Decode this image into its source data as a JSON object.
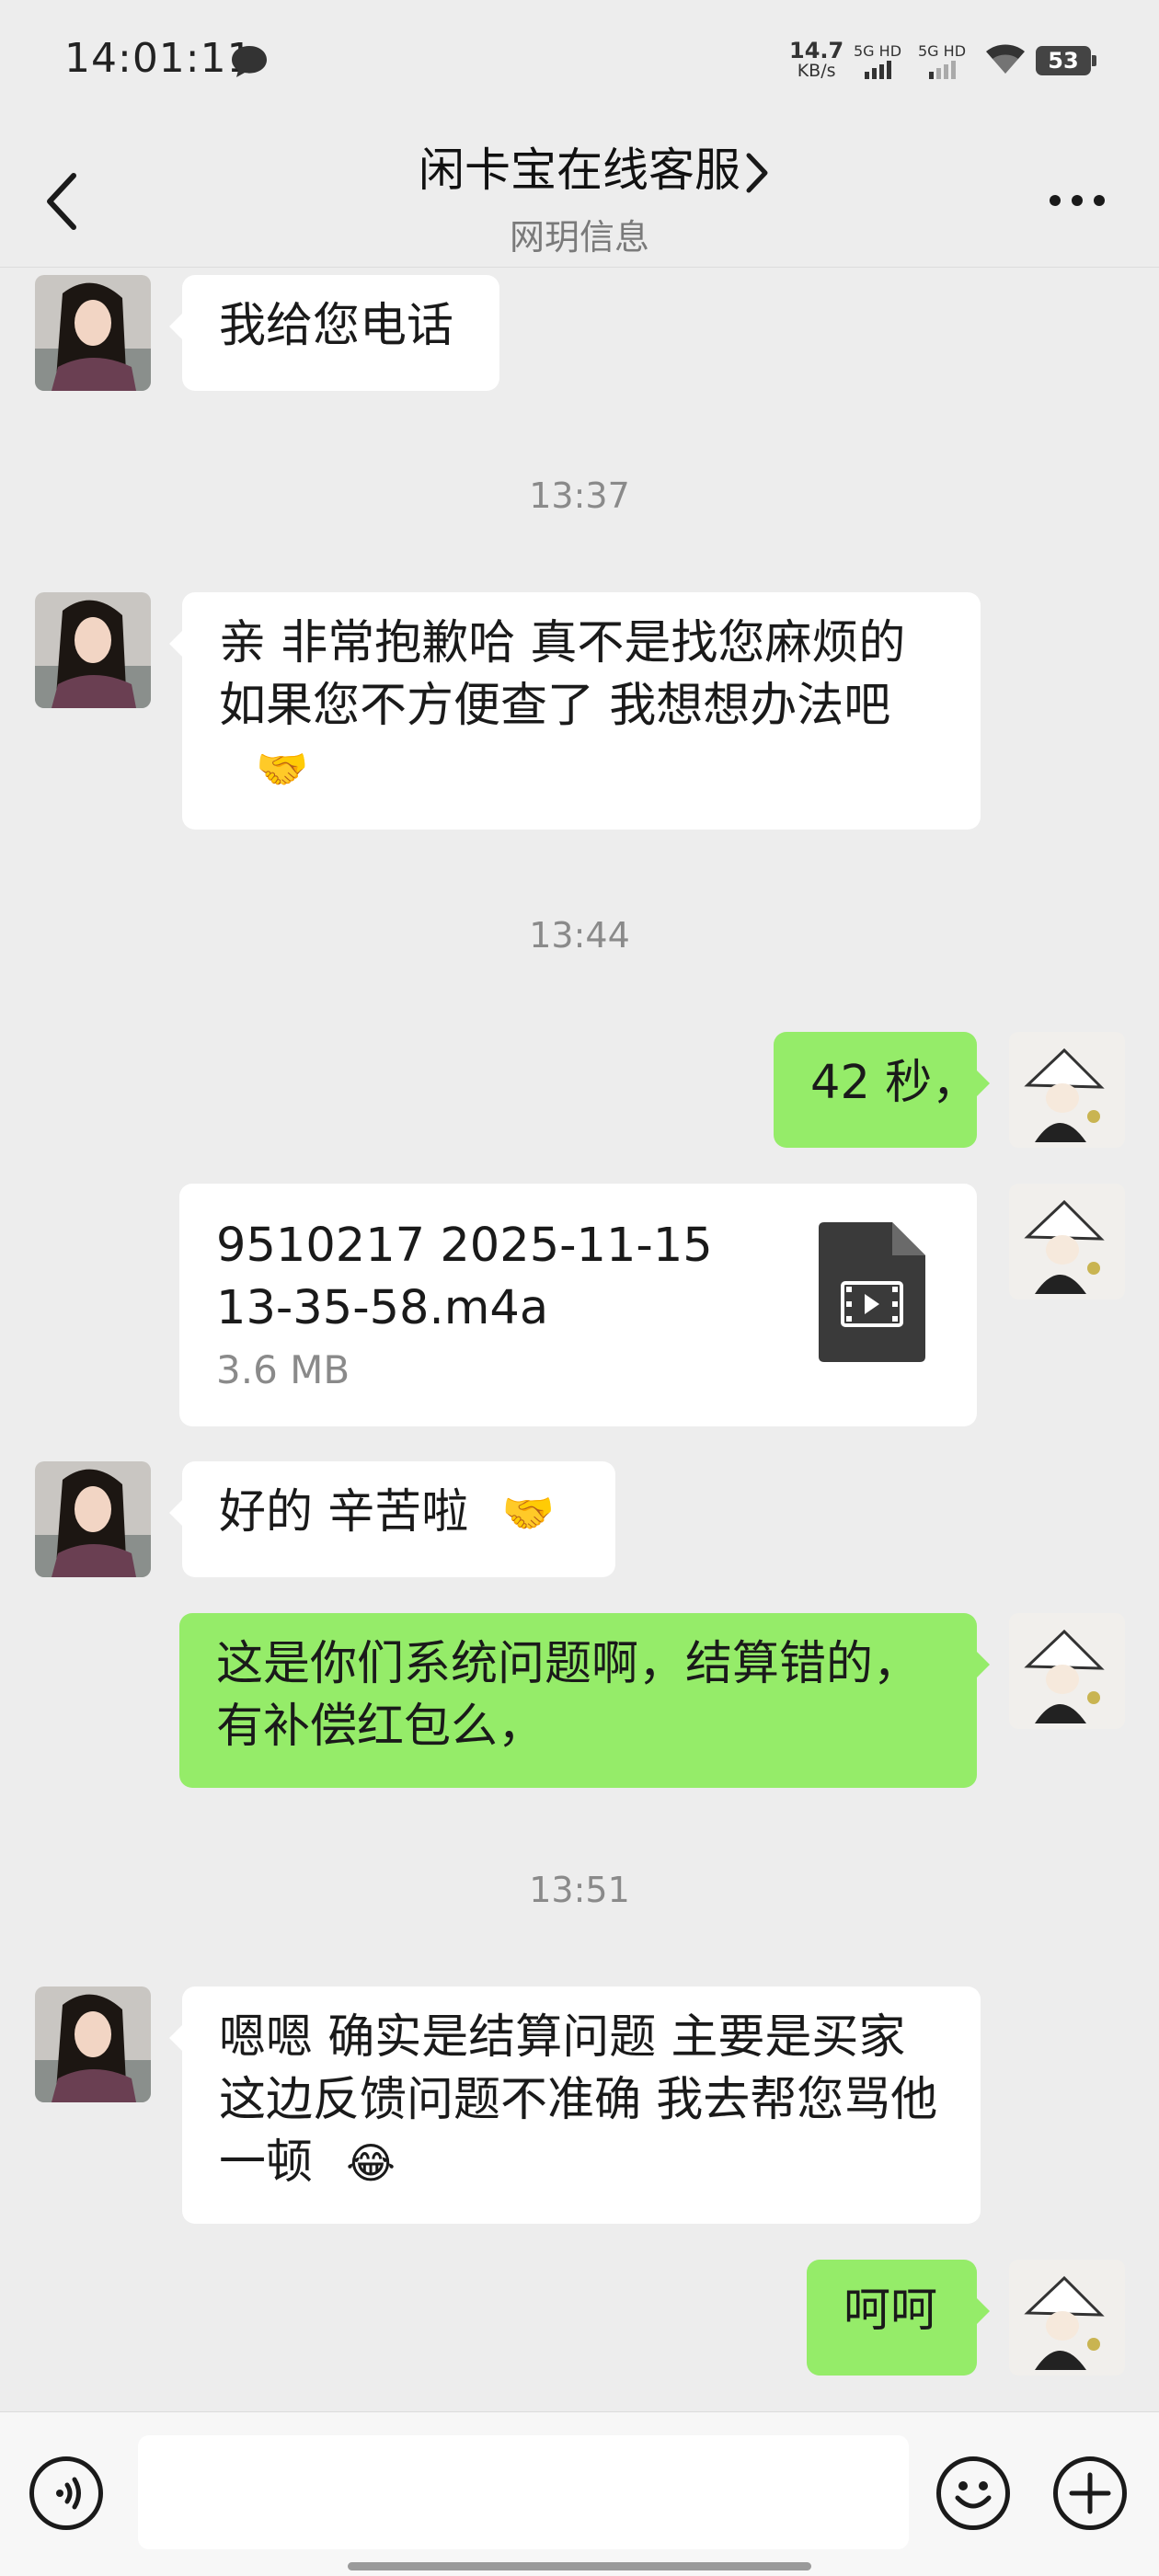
{
  "status_bar": {
    "time": "14:01:11",
    "net_speed_value": "14.7",
    "net_speed_unit": "KB/s",
    "signal_1_label": "5G HD",
    "signal_2_label": "5G HD",
    "battery_level": "53"
  },
  "header": {
    "title": "闲卡宝在线客服",
    "subtitle": "网玥信息"
  },
  "messages": [
    {
      "text": "我给您电话"
    },
    {
      "timestamp": "13:37"
    },
    {
      "text": "亲  非常抱歉哈  真不是找您麻烦的  如果您不方便查了  我想想办法吧"
    },
    {
      "timestamp": "13:44"
    },
    {
      "text": "42 秒，"
    },
    {
      "file_name_line1": "9510217 2025-11-15",
      "file_name_line2": "13-35-58.m4a",
      "file_size": "3.6 MB"
    },
    {
      "text": "好的  辛苦啦"
    },
    {
      "text": "这是你们系统问题啊，结算错的，有补偿红包么，"
    },
    {
      "timestamp": "13:51"
    },
    {
      "text": "嗯嗯  确实是结算问题  主要是买家这边反馈问题不准确  我去帮您骂他一顿"
    },
    {
      "text": "呵呵"
    }
  ],
  "icons": {
    "back": "chevron-left-icon",
    "title_arrow": "chevron-right-icon",
    "more": "more-icon",
    "voice": "voice-icon",
    "emoji": "emoji-icon",
    "plus": "plus-icon",
    "handshake": "🤝",
    "laugh": "😂"
  },
  "colors": {
    "background": "#ededed",
    "incoming_bubble": "#ffffff",
    "outgoing_bubble": "#95ec69",
    "file_icon": "#3a3a3a"
  }
}
